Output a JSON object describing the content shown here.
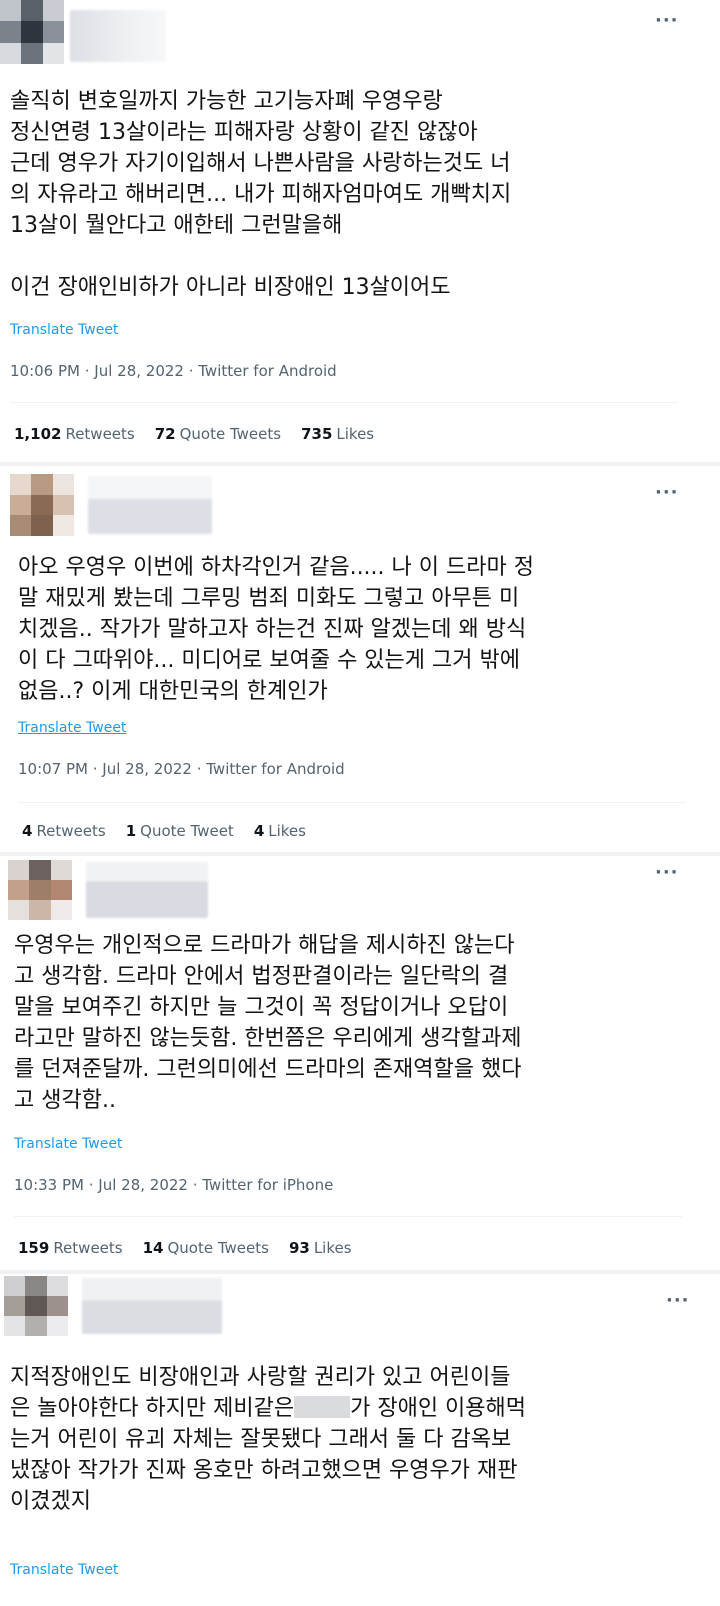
{
  "tweets": [
    {
      "text": "솔직히 변호일까지 가능한 고기능자폐 우영우랑\n정신연령 13살이라는 피해자랑 상황이 같진 않잖아\n근데 영우가 자기이입해서 나쁜사람을 사랑하는것도 너\n의 자유라고 해버리면... 내가 피해자엄마여도 개빡치지\n13살이 뭘안다고 애한테 그런말을해\n\n이건 장애인비하가 아니라 비장애인 13살이어도",
      "translate": "Translate Tweet",
      "meta": "10:06 PM · Jul 28, 2022 · Twitter for Android",
      "retweets": "1,102",
      "retweets_label": "Retweets",
      "quotes": "72",
      "quotes_label": "Quote Tweets",
      "likes": "735",
      "likes_label": "Likes"
    },
    {
      "text": "아오 우영우 이번에 하차각인거 같음..... 나 이 드라마 정\n말 재밌게 봤는데 그루밍 범죄 미화도 그렇고 아무튼 미\n치겠음.. 작가가 말하고자 하는건 진짜 알겠는데 왜 방식\n이 다 그따위야... 미디어로 보여줄 수 있는게 그거 밖에\n없음..? 이게 대한민국의 한계인가",
      "translate": "Translate Tweet",
      "meta": "10:07 PM · Jul 28, 2022 · Twitter for Android",
      "retweets": "4",
      "retweets_label": "Retweets",
      "quotes": "1",
      "quotes_label": "Quote Tweet",
      "likes": "4",
      "likes_label": "Likes"
    },
    {
      "text": "우영우는 개인적으로 드라마가 해답을 제시하진 않는다\n고 생각함. 드라마 안에서 법정판결이라는 일단락의 결\n말을 보여주긴 하지만 늘 그것이 꼭 정답이거나 오답이\n라고만 말하진 않는듯함. 한번쯤은 우리에게 생각할과제\n를 던져준달까. 그런의미에선 드라마의 존재역할을 했다\n고 생각함..",
      "translate": "Translate Tweet",
      "meta": "10:33 PM · Jul 28, 2022 · Twitter for iPhone",
      "retweets": "159",
      "retweets_label": "Retweets",
      "quotes": "14",
      "quotes_label": "Quote Tweets",
      "likes": "93",
      "likes_label": "Likes"
    },
    {
      "text_a": "지적장애인도 비장애인과 사랑할 권리가 있고 어린이들\n은 놀아야한다 하지만 제비같은",
      "text_b": "가 장애인 이용해먹\n는거 어린이 유괴 자체는 잘못됐다 그래서 둘 다 감옥보\n냈잖아 작가가 진짜 옹호만 하려고했으면 우영우가 재판\n이겼겠지",
      "translate": "Translate Tweet"
    }
  ],
  "more_icon": "···",
  "colors": {
    "link": "#1d9bf0",
    "muted": "#536471",
    "text": "#0f1419"
  }
}
